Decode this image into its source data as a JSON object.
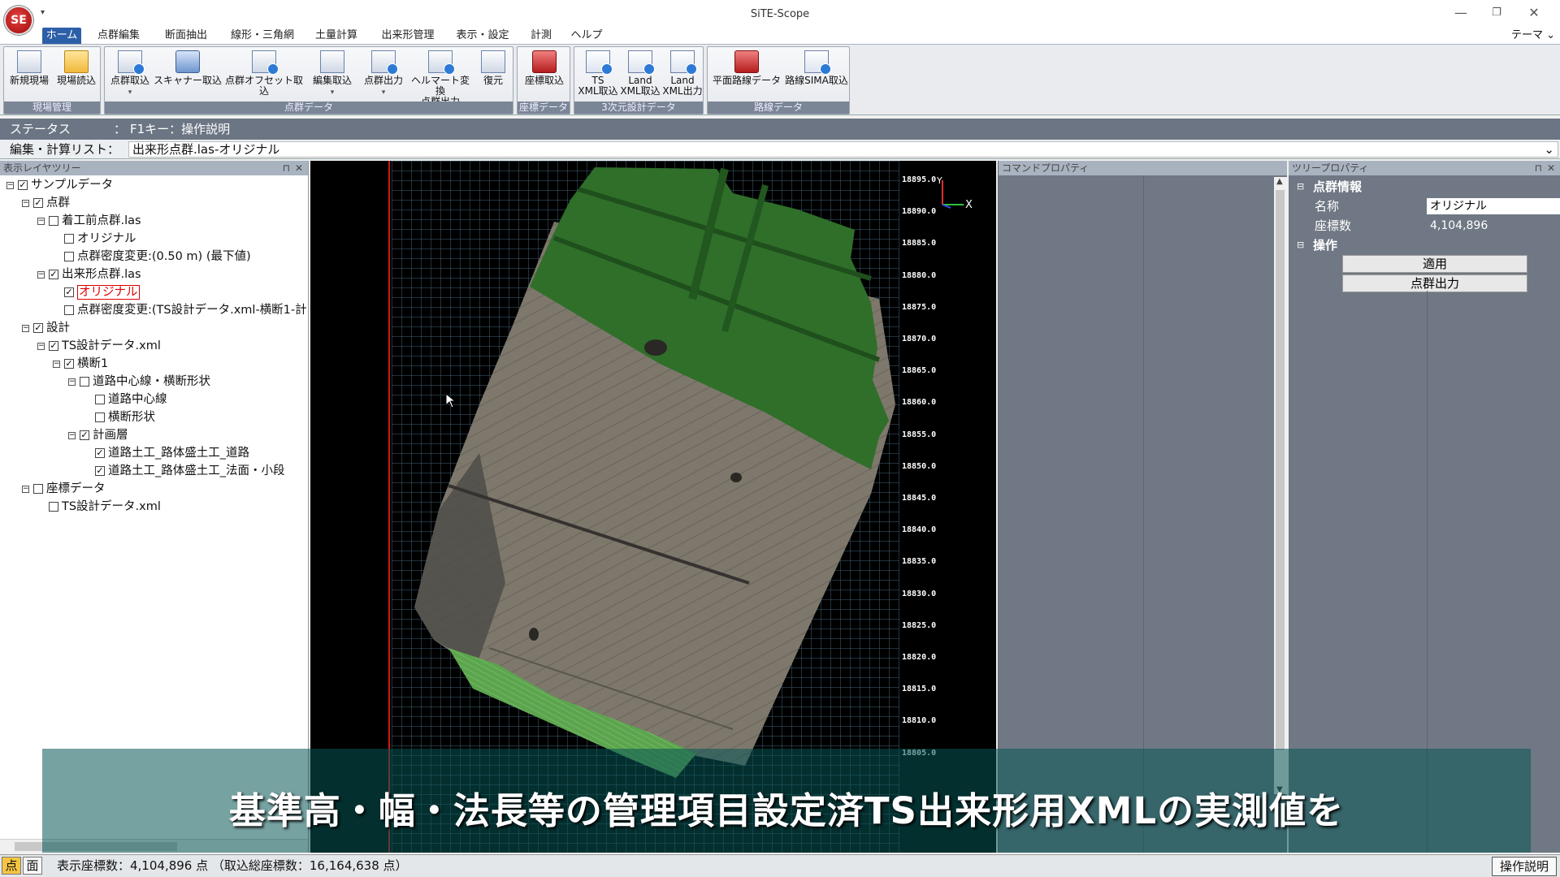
{
  "window": {
    "title": "SiTE-Scope",
    "logo_text": "SE",
    "minimize": "—",
    "restore": "❐",
    "close": "✕",
    "qa_arrow": "▾"
  },
  "tabs": [
    "ホーム",
    "点群編集",
    "断面抽出",
    "線形・三角網",
    "土量計算",
    "出来形管理",
    "表示・設定",
    "計測",
    "ヘルプ"
  ],
  "theme_menu": "テーマ ⌄",
  "ribbon": {
    "groups": [
      {
        "caption": "現場管理",
        "buttons": [
          {
            "label": "新規現場"
          },
          {
            "label": "現場読込"
          }
        ]
      },
      {
        "caption": "点群データ",
        "buttons": [
          {
            "label": "点群取込"
          },
          {
            "label": "スキャナー取込"
          },
          {
            "label": "点群オフセット取込"
          },
          {
            "label": "編集取込"
          },
          {
            "label": "点群出力"
          },
          {
            "label": "ヘルマート変換",
            "label2": "点群出力"
          },
          {
            "label": "復元"
          }
        ]
      },
      {
        "caption": "座標データ",
        "buttons": [
          {
            "label": "座標取込"
          }
        ]
      },
      {
        "caption": "3次元設計データ",
        "buttons": [
          {
            "label": "TS",
            "label2": "XML取込"
          },
          {
            "label": "Land",
            "label2": "XML取込"
          },
          {
            "label": "Land",
            "label2": "XML出力"
          }
        ]
      },
      {
        "caption": "路線データ",
        "buttons": [
          {
            "label": "平面路線データ"
          },
          {
            "label": "路線SIMA取込"
          }
        ]
      }
    ]
  },
  "status": {
    "label": "ステータス",
    "sep": "：",
    "text": "F1キー：操作説明"
  },
  "edit_list": {
    "label": "編集・計算リスト：",
    "value": "出来形点群.las-オリジナル",
    "arrow": "⌄"
  },
  "tree": {
    "header": "表示レイヤツリー",
    "pin": "⊓",
    "close": "✕",
    "nodes": [
      {
        "label": "サンプルデータ",
        "checked": true,
        "expand": "−"
      },
      {
        "label": "点群",
        "checked": true,
        "expand": "−"
      },
      {
        "label": "着工前点群.las",
        "checked": false,
        "expand": "−"
      },
      {
        "label": "オリジナル",
        "checked": false
      },
      {
        "label": "点群密度変更:(0.50 m) (最下値)",
        "checked": false
      },
      {
        "label": "出来形点群.las",
        "checked": true,
        "expand": "−"
      },
      {
        "label": "オリジナル",
        "checked": true,
        "selected": true
      },
      {
        "label": "点群密度変更:(TS設計データ.xml-横断1-計",
        "checked": false
      },
      {
        "label": "設計",
        "checked": true,
        "expand": "−"
      },
      {
        "label": "TS設計データ.xml",
        "checked": true,
        "expand": "−"
      },
      {
        "label": "横断1",
        "checked": true,
        "expand": "−"
      },
      {
        "label": "道路中心線・横断形状",
        "checked": false,
        "expand": "−"
      },
      {
        "label": "道路中心線",
        "checked": false
      },
      {
        "label": "横断形状",
        "checked": false
      },
      {
        "label": "計画層",
        "checked": true,
        "expand": "−"
      },
      {
        "label": "道路土工_路体盛土工_道路",
        "checked": true
      },
      {
        "label": "道路土工_路体盛土工_法面・小段",
        "checked": true
      },
      {
        "label": "座標データ",
        "checked": false,
        "expand": "−"
      },
      {
        "label": "TS設計データ.xml",
        "checked": false
      }
    ]
  },
  "viewport": {
    "y_ticks": [
      "18895.0",
      "18890.0",
      "18885.0",
      "18880.0",
      "18875.0",
      "18870.0",
      "18865.0",
      "18860.0",
      "18855.0",
      "18850.0",
      "18845.0",
      "18840.0",
      "18835.0",
      "18830.0",
      "18825.0",
      "18820.0",
      "18815.0",
      "18810.0",
      "18805.0"
    ],
    "axis_y": "Y",
    "axis_x": "X",
    "colors": {
      "grass": "#2f6f2a",
      "soil": "#7d776b",
      "slope": "#5fa651"
    }
  },
  "command_panel": {
    "header": "コマンドプロパティ"
  },
  "tree_props": {
    "header": "ツリープロパティ",
    "pin": "⊓",
    "close": "✕",
    "section_info": "点群情報",
    "name_label": "名称",
    "name_value": "オリジナル",
    "count_label": "座標数",
    "count_value": "4,104,896",
    "section_ops": "操作",
    "apply_button": "適用",
    "export_button": "点群出力"
  },
  "caption": "基準高・幅・法長等の管理項目設定済TS出来形用XMLの実測値を",
  "bottom": {
    "mode_point": "点",
    "mode_face": "面",
    "info": "表示座標数：4,104,896 点 （取込総座標数：16,164,638 点）",
    "help": "操作説明"
  }
}
